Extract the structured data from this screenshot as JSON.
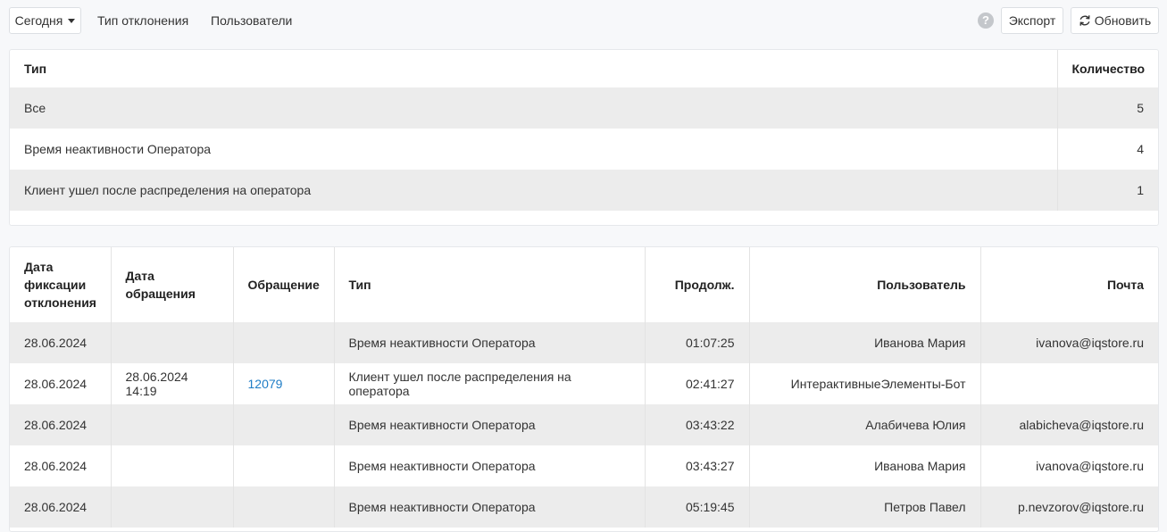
{
  "toolbar": {
    "period_label": "Сегодня",
    "tab_deviation_type": "Тип отклонения",
    "tab_users": "Пользователи",
    "help_glyph": "?",
    "export_label": "Экспорт",
    "refresh_label": "Обновить"
  },
  "summary": {
    "headers": {
      "type": "Тип",
      "count": "Количество"
    },
    "rows": [
      {
        "type": "Все",
        "count": "5"
      },
      {
        "type": "Время неактивности Оператора",
        "count": "4"
      },
      {
        "type": "Клиент ушел после распределения на оператора",
        "count": "1"
      }
    ]
  },
  "details": {
    "headers": {
      "fix_date": "Дата фиксации отклонения",
      "request_date": "Дата обращения",
      "request": "Обращение",
      "type": "Тип",
      "duration": "Продолж.",
      "user": "Пользователь",
      "email": "Почта"
    },
    "rows": [
      {
        "fix_date": "28.06.2024",
        "request_date": "",
        "request": "",
        "type": "Время неактивности Оператора",
        "duration": "01:07:25",
        "user": "Иванова Мария",
        "email": "ivanova@iqstore.ru"
      },
      {
        "fix_date": "28.06.2024",
        "request_date": "28.06.2024 14:19",
        "request": "12079",
        "type": "Клиент ушел после распределения на оператора",
        "duration": "02:41:27",
        "user": "ИнтерактивныеЭлементы-Бот",
        "email": ""
      },
      {
        "fix_date": "28.06.2024",
        "request_date": "",
        "request": "",
        "type": "Время неактивности Оператора",
        "duration": "03:43:22",
        "user": "Алабичева Юлия",
        "email": "alabicheva@iqstore.ru"
      },
      {
        "fix_date": "28.06.2024",
        "request_date": "",
        "request": "",
        "type": "Время неактивности Оператора",
        "duration": "03:43:27",
        "user": "Иванова Мария",
        "email": "ivanova@iqstore.ru"
      },
      {
        "fix_date": "28.06.2024",
        "request_date": "",
        "request": "",
        "type": "Время неактивности Оператора",
        "duration": "05:19:45",
        "user": "Петров Павел",
        "email": "p.nevzorov@iqstore.ru"
      }
    ]
  },
  "colors": {
    "link": "#1f7dc6",
    "row_alt": "#ececec"
  }
}
